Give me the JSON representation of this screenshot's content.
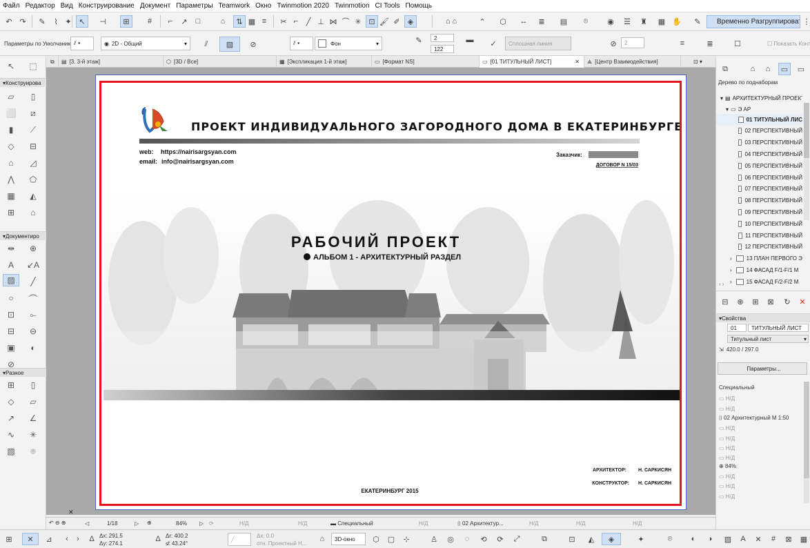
{
  "menu": [
    "Файл",
    "Редактор",
    "Вид",
    "Конструирование",
    "Документ",
    "Параметры",
    "Teamwork",
    "Окно",
    "Twinmotion 2020",
    "Twinmotion",
    "CI Tools",
    "Помощь"
  ],
  "toolbar": {
    "regroup_label": "Временно Разгруппировать",
    "default_params": "Параметры по Умолчанию",
    "view_2d": "2D - Общий",
    "fill_bg": "Фон",
    "pen1": "2",
    "pen2": "122",
    "line_type": "Сплошная линия",
    "pen3": "2",
    "show_contour": "Показать Конту"
  },
  "tabs": [
    "[3. 3-й этаж]",
    "[3D / Все]",
    "[Экспликация 1-й этаж]",
    "[Формат NS]",
    "[01 ТИТУЛЬНЫЙ ЛИСТ]",
    "[Центр Взаимодействия]"
  ],
  "left_panel": {
    "construction": "Конструирова",
    "documentation": "Документиро",
    "misc": "Разное"
  },
  "sheet": {
    "title": "ПРОЕКТ ИНДИВИДУАЛЬНОГО ЗАГОРОДНОГО ДОМА В ЕКАТЕРИНБУРГЕ",
    "web_label": "web:",
    "web_value": "https://nairisargsyan.com",
    "email_label": "email:",
    "email_value": "info@nairisargsyan.com",
    "customer_label": "Заказчик:",
    "contract": "ДОГОВОР N 15/03",
    "project_title": "РАБОЧИЙ ПРОЕКТ",
    "album": "АЛЬБОМ 1  -  АРХИТЕКТУРНЫЙ РАЗДЕЛ",
    "architect_label": "АРХИТЕКТОР:",
    "architect_name": "Н. САРКИСЯН",
    "constructor_label": "КОНСТРУКТОР:",
    "constructor_name": "Н. САРКИСЯН",
    "city": "ЕКАТЕРИНБУРГ 2015"
  },
  "right_panel": {
    "tree_header": "Дерево по поднаборам",
    "root": "АРХИТЕКТУРНЫЙ ПРОЕКТ",
    "subset": "Э АР",
    "items": [
      "01 ТИТУЛЬНЫЙ ЛИС",
      "02 ПЕРСПЕКТИВНЫЙ",
      "03 ПЕРСПЕКТИВНЫЙ",
      "04 ПЕРСПЕКТИВНЫЙ",
      "05 ПЕРСПЕКТИВНЫЙ",
      "06 ПЕРСПЕКТИВНЫЙ",
      "07 ПЕРСПЕКТИВНЫЙ",
      "08 ПЕРСПЕКТИВНЫЙ",
      "09 ПЕРСПЕКТИВНЫЙ",
      "10 ПЕРСПЕКТИВНЫЙ",
      "11 ПЕРСПЕКТИВНЫЙ",
      "12 ПЕРСПЕКТИВНЫЙ",
      "13 ПЛАН ПЕРВОГО Э",
      "14 ФАСАД F/1-F/1 М",
      "15 ФАСАД F/2-F/2 М"
    ],
    "properties_header": "Свойства",
    "num": "01",
    "name": "ТИТУЛЬНЫЙ ЛИСТ",
    "type": "Титульный лист",
    "size": "420.0 / 297.0",
    "params_button": "Параметры...",
    "special": "Специальный",
    "nd": "Н/Д",
    "arch_scale": "02 Архитектурный М 1:50",
    "zoom": "84%"
  },
  "status": {
    "page": "1/18",
    "zoom": "84%",
    "nd": "Н/Д",
    "special": "Специальный",
    "arch": "02 Архитектур..."
  },
  "bottom": {
    "dx": "Δx: 291.5",
    "dy": "Δy: 274.1",
    "dr": "Δr: 400.2",
    "da": "≰: 43.24°",
    "x0": "Δx: 0.0",
    "ref": "отн. Проектный Н...",
    "view3d": "3D-окно"
  },
  "colors": {
    "frame": "#e8141c",
    "selection": "#cfe0f4",
    "accent": "#2f6fb3"
  }
}
